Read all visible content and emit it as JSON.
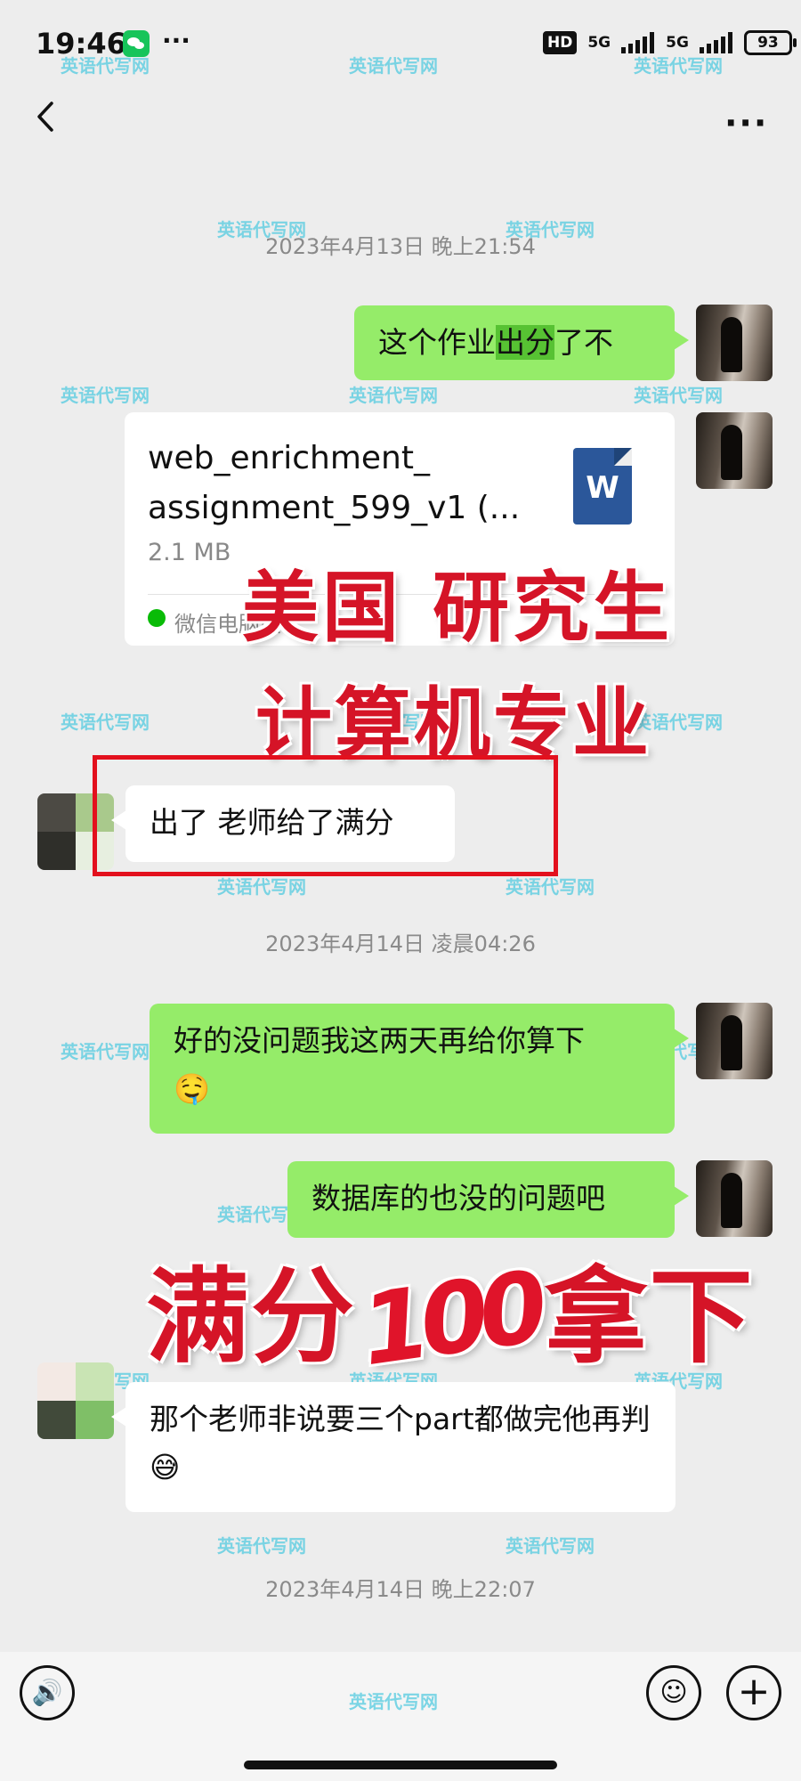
{
  "status_bar": {
    "time": "19:46",
    "network": "5G",
    "network2": "5G",
    "hd": "HD",
    "battery": "93",
    "extra": "···"
  },
  "header": {
    "more": "···"
  },
  "timestamps": [
    "2023年4月13日 晚上21:54",
    "2023年4月14日 凌晨04:26",
    "2023年4月14日 晚上22:07"
  ],
  "messages": {
    "m1_before": "这个作业",
    "m1_highlight": "出分",
    "m1_after": "了不",
    "file_name": "web_enrichment_ assignment_599_v1 (...",
    "file_size": "2.1 MB",
    "file_source": "微信电脑版",
    "file_icon_letter": "W",
    "m2": "出了 老师给了满分",
    "m3": "好的没问题我这两天再给你算下",
    "m3_emoji": "🤤",
    "m4": "数据库的也没的问题吧",
    "m5": "那个老师非说要三个part都做完他再判",
    "m5_emoji": "😅"
  },
  "overlay": {
    "line1": "美国 研究生",
    "line2": "计算机专业",
    "line3_a": "满分",
    "line3_num": "100",
    "line3_b": "拿下"
  },
  "watermark": "英语代写网",
  "input_bar": {
    "voice": "🔊",
    "emoji": "☺",
    "plus": "+"
  }
}
